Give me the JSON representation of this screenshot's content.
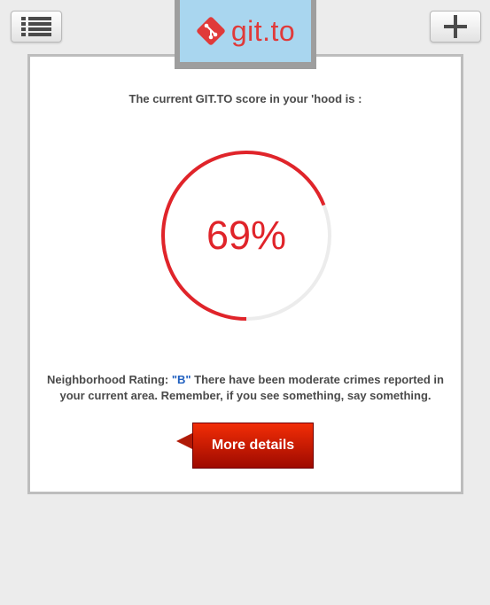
{
  "header": {
    "logo_text": "git.to",
    "menu_icon": "list-icon",
    "add_icon": "plus-icon"
  },
  "score": {
    "title": "The current GIT.TO score in your 'hood is :",
    "value_text": "69%",
    "value": 69
  },
  "rating": {
    "label": "Neighborhood Rating: ",
    "grade": "\"B\"",
    "description": " There have been moderate crimes reported in your current area. Remember, if you see something, say something."
  },
  "actions": {
    "more_details_label": "More details"
  },
  "colors": {
    "accent": "#e0242a",
    "grade": "#1f5fbf",
    "logo_background": "#a9d6ef",
    "button_top": "#f22d06",
    "button_bottom": "#9e0a00"
  }
}
